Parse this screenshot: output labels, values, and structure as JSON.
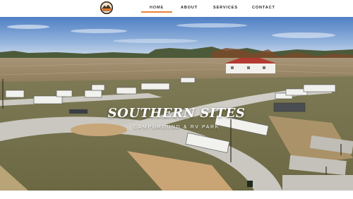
{
  "brand": {
    "logo_icon": "campground-logo-icon",
    "logo_text": "SOUTHERN SITES"
  },
  "nav": {
    "items": [
      {
        "label": "HOME",
        "active": true
      },
      {
        "label": "ABOUT",
        "active": false
      },
      {
        "label": "SERVICES",
        "active": false
      },
      {
        "label": "CONTACT",
        "active": false
      }
    ],
    "accent_color": "#e8823a"
  },
  "hero": {
    "title": "SOUTHERN SITES",
    "subtitle": "CAMPGROUND & RV PARK",
    "image": "aerial-campground-photo"
  }
}
